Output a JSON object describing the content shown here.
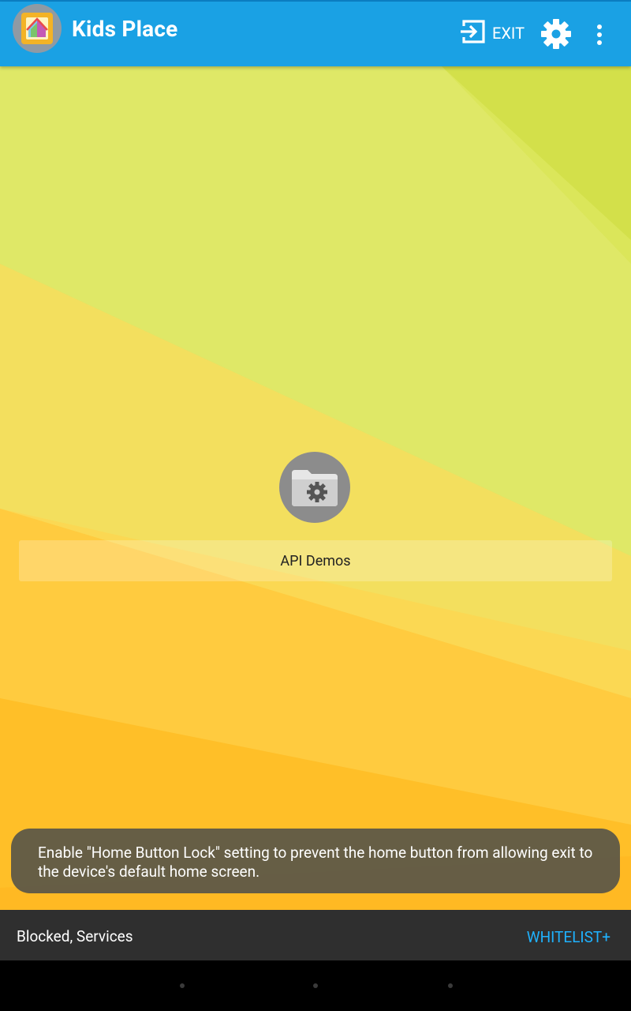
{
  "app_bar": {
    "title": "Kids Place",
    "logo_icon": "kids-place-logo-icon",
    "exit_label": "EXIT",
    "exit_icon": "exit-arrow-icon",
    "settings_icon": "gear-icon",
    "overflow_icon": "more-vert-icon",
    "background_color": "#1aa1e4"
  },
  "home": {
    "apps": [
      {
        "label": "API Demos",
        "icon": "folder-gear-icon"
      }
    ]
  },
  "toast": {
    "message": "Enable \"Home Button Lock\" setting to prevent the home button from allowing exit to the device's default home screen."
  },
  "bottom_bar": {
    "status": "Blocked, Services",
    "whitelist_label": "WHITELIST+",
    "accent_color": "#1fb2ff"
  },
  "nav_bar": {
    "buttons": [
      "back-dot",
      "home-dot",
      "recents-dot"
    ]
  }
}
